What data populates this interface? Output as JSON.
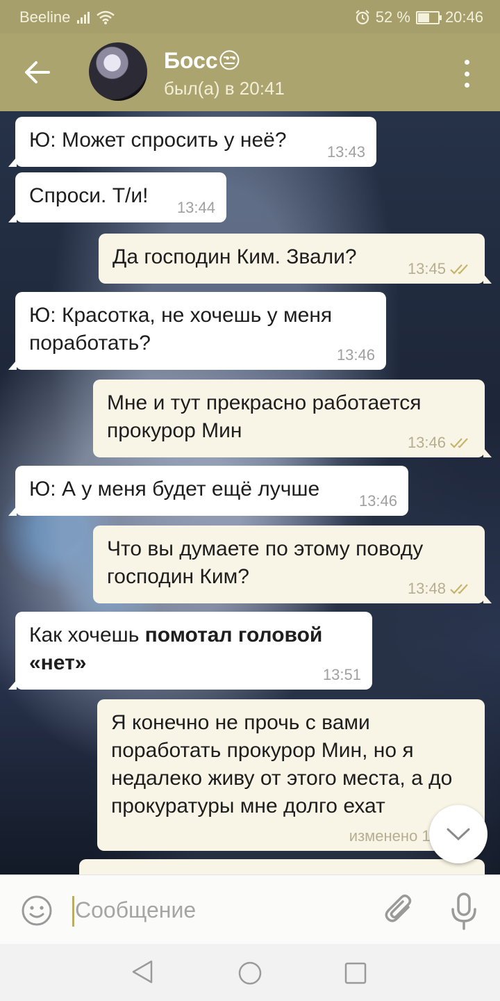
{
  "status_bar": {
    "carrier": "Beeline",
    "battery_percent": "52 %",
    "time": "20:46",
    "battery_level": 0.52
  },
  "header": {
    "name": "Босс😒",
    "last_seen": "был(а) в 20:41"
  },
  "messages": [
    {
      "direction": "in",
      "text": "Ю: Может спросить у неё?",
      "time": "13:43"
    },
    {
      "direction": "in",
      "text": "Спроси. Т/и!",
      "time": "13:44"
    },
    {
      "direction": "out",
      "text": "Да господин Ким. Звали?",
      "time": "13:45",
      "read": true
    },
    {
      "direction": "in",
      "text": "Ю: Красотка, не хочешь у меня поработать?",
      "time": "13:46"
    },
    {
      "direction": "out",
      "text": "Мне и тут прекрасно работается прокурор Мин",
      "time": "13:46",
      "read": true
    },
    {
      "direction": "in",
      "text": "Ю: А у меня будет ещё лучше",
      "time": "13:46"
    },
    {
      "direction": "out",
      "text": "Что вы думаете по этому поводу господин Ким?",
      "time": "13:48",
      "read": true
    },
    {
      "direction": "in",
      "text_plain": "Как хочешь ",
      "text_bold": "помотал головой «нет»",
      "time": "13:51"
    },
    {
      "direction": "out",
      "text": "Я конечно не прочь с вами поработать прокурор Мин, но я недалеко живу от этого места, а до прокуратуры мне долго ехат",
      "time": "изменено 13:"
    }
  ],
  "input": {
    "placeholder": "Сообщение"
  },
  "colors": {
    "header": "#aca46e",
    "status_bar": "#a69f6b",
    "incoming_bubble": "#ffffff",
    "outgoing_bubble": "#f9f5e6",
    "read_check": "#c6b46a"
  },
  "icons": {
    "back": "arrow-left-icon",
    "menu": "more-vertical-icon",
    "emoji": "smiley-icon",
    "attach": "paperclip-icon",
    "mic": "microphone-icon",
    "scroll": "chevron-down-icon"
  }
}
